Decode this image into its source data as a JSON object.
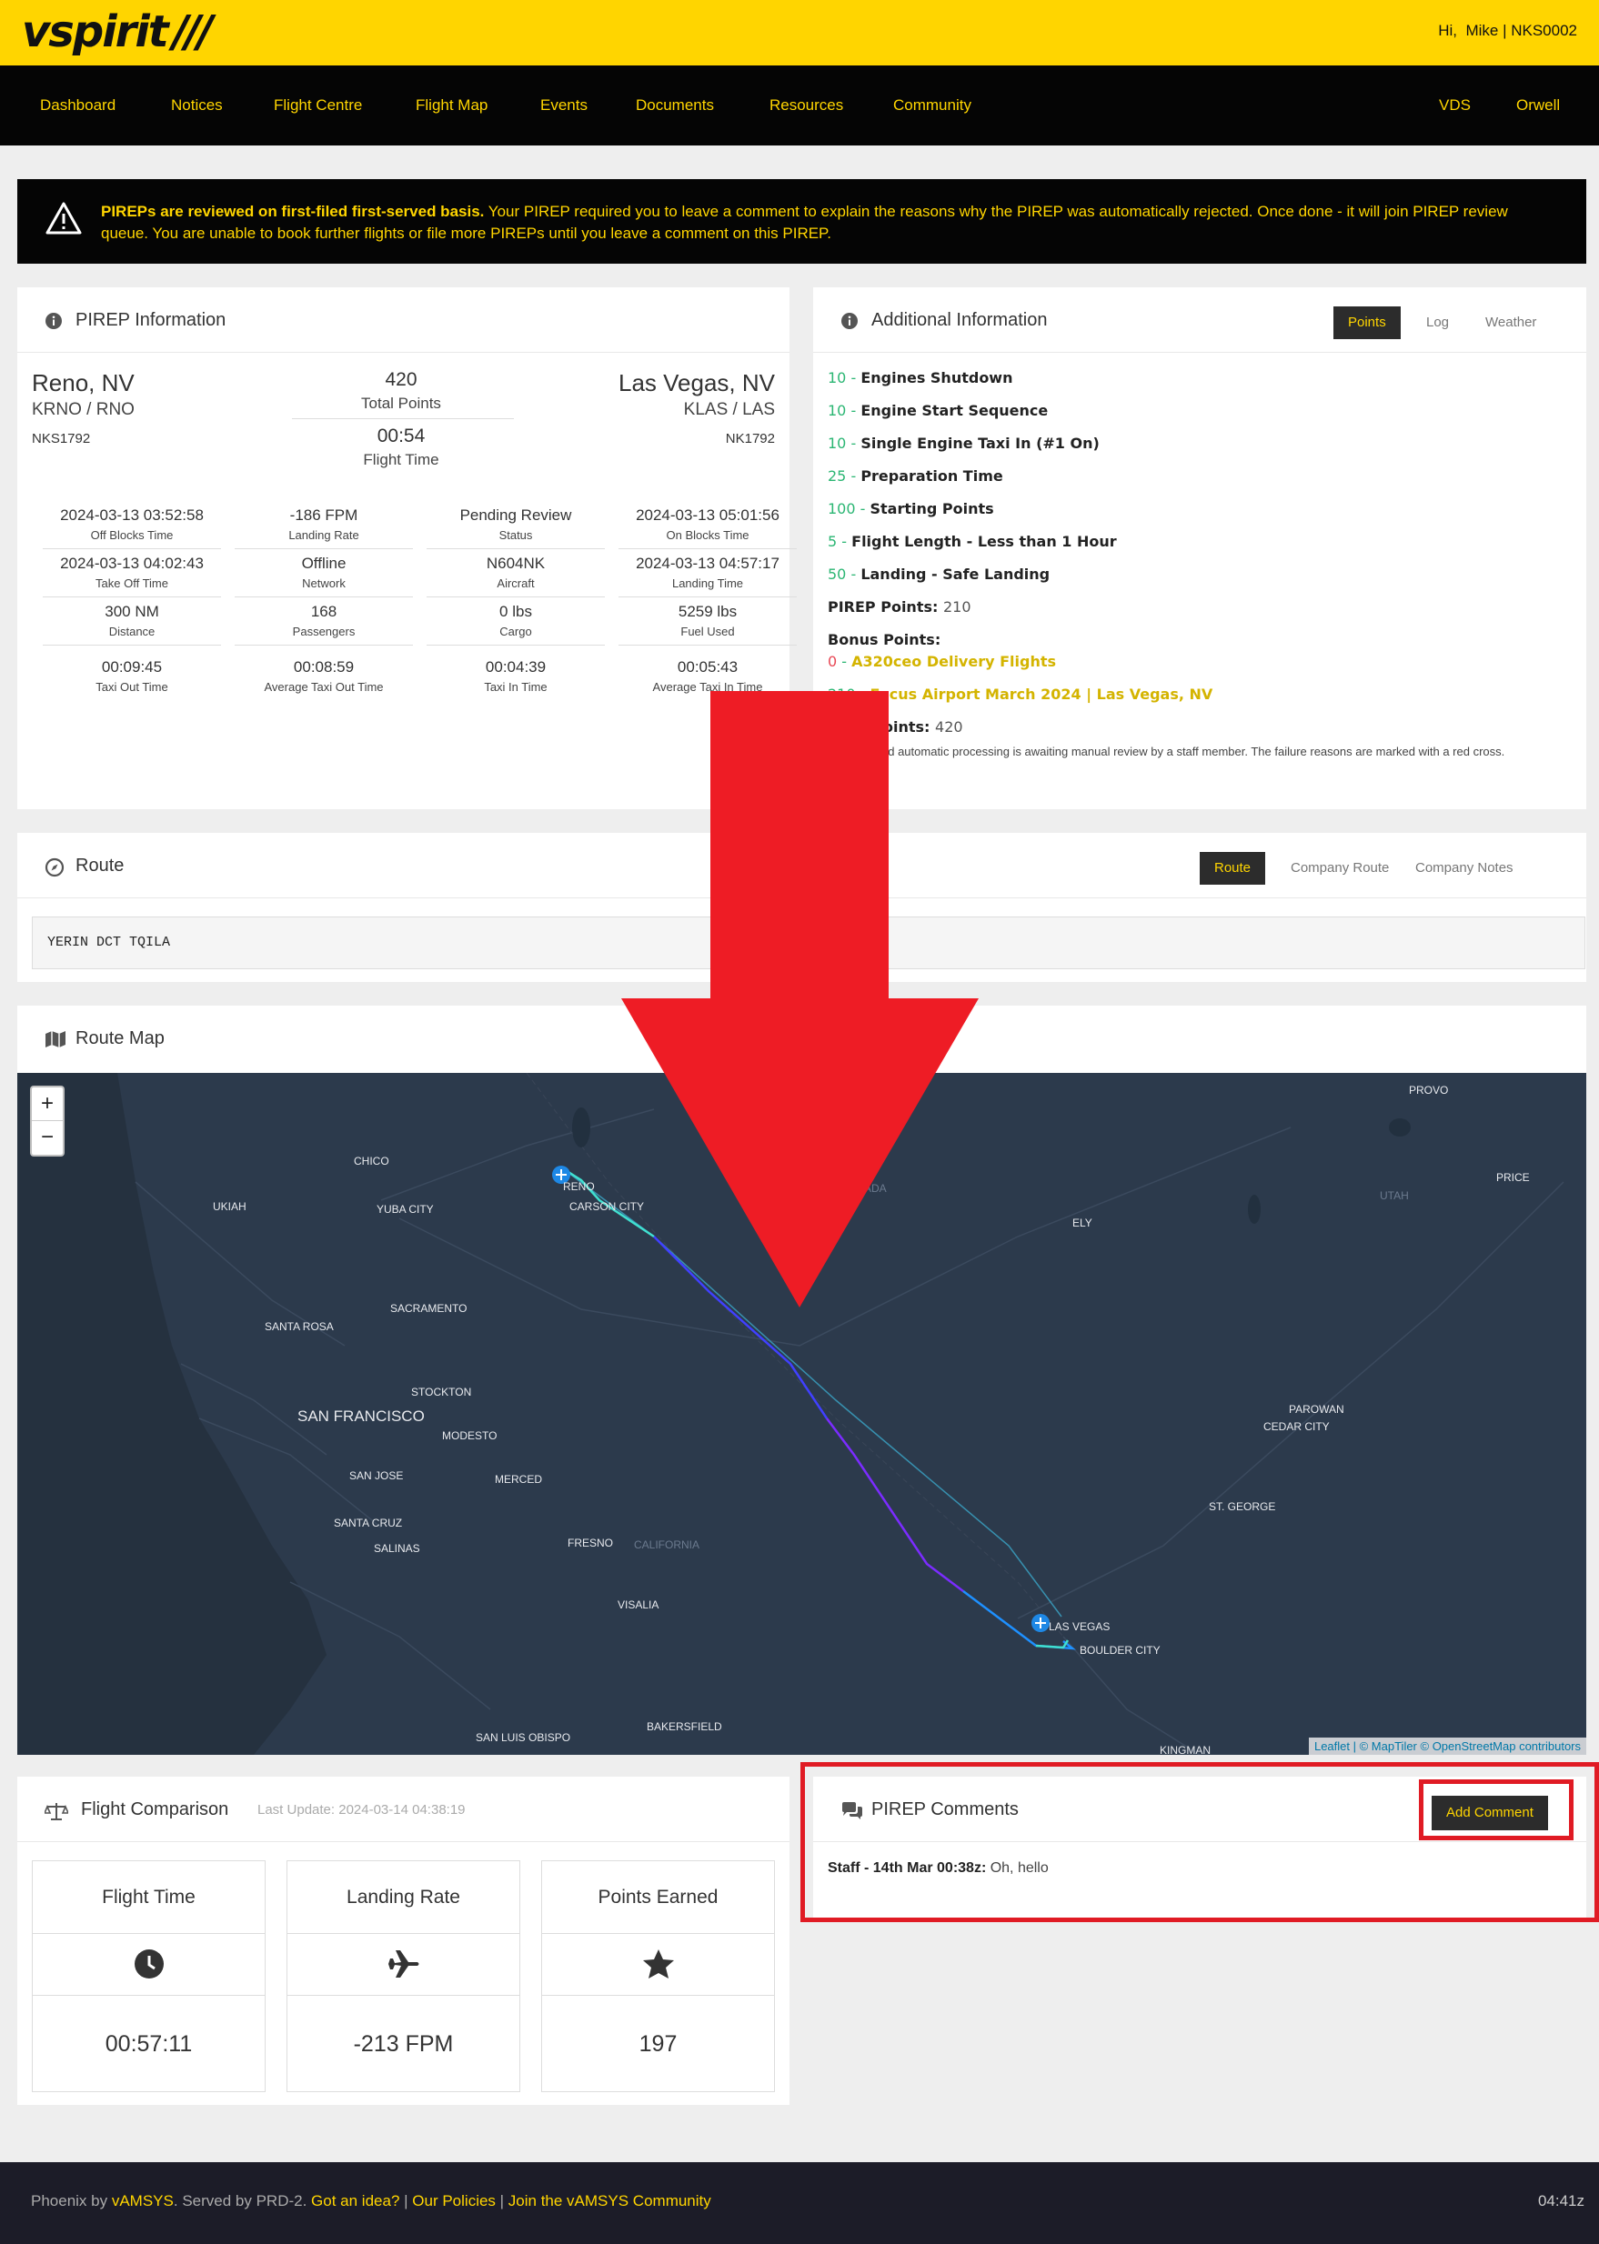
{
  "header": {
    "logo": "vspirit",
    "logo_mark": "///",
    "greeting_prefix": "Hi,",
    "user": "Mike | NKS0002"
  },
  "nav": {
    "items": [
      "Dashboard",
      "Notices",
      "Flight Centre",
      "Flight Map",
      "Events",
      "Documents",
      "Resources",
      "Community"
    ],
    "right_items": [
      "VDS",
      "Orwell"
    ]
  },
  "banner": {
    "bold": "PIREPs are reviewed on first-filed first-served basis.",
    "text": " Your PIREP required you to leave a comment to explain the reasons why the PIREP was automatically rejected. Once done - it will join PIREP review queue. You are unable to book further flights or file more PIREPs until you leave a comment on this PIREP."
  },
  "pirep": {
    "title": "PIREP Information",
    "dep_city": "Reno, NV",
    "dep_codes": "KRNO / RNO",
    "dep_flight": "NKS1792",
    "arr_city": "Las Vegas, NV",
    "arr_codes": "KLAS / LAS",
    "arr_flight": "NK1792",
    "total_points": "420",
    "total_points_label": "Total Points",
    "flight_time": "00:54",
    "flight_time_label": "Flight Time",
    "stats": [
      [
        {
          "value": "2024-03-13 03:52:58",
          "label": "Off Blocks Time"
        },
        {
          "value": "-186 FPM",
          "label": "Landing Rate"
        },
        {
          "value": "Pending Review",
          "label": "Status"
        },
        {
          "value": "2024-03-13 05:01:56",
          "label": "On Blocks Time"
        }
      ],
      [
        {
          "value": "2024-03-13 04:02:43",
          "label": "Take Off Time"
        },
        {
          "value": "Offline",
          "label": "Network"
        },
        {
          "value": "N604NK",
          "label": "Aircraft"
        },
        {
          "value": "2024-03-13 04:57:17",
          "label": "Landing Time"
        }
      ],
      [
        {
          "value": "300 NM",
          "label": "Distance"
        },
        {
          "value": "168",
          "label": "Passengers"
        },
        {
          "value": "0 lbs",
          "label": "Cargo"
        },
        {
          "value": "5259 lbs",
          "label": "Fuel Used"
        }
      ],
      [
        {
          "value": "00:09:45",
          "label": "Taxi Out Time"
        },
        {
          "value": "00:08:59",
          "label": "Average Taxi Out Time"
        },
        {
          "value": "00:04:39",
          "label": "Taxi In Time"
        },
        {
          "value": "00:05:43",
          "label": "Average Taxi In Time"
        }
      ]
    ]
  },
  "additional": {
    "title": "Additional Information",
    "tabs": [
      "Points",
      "Log",
      "Weather"
    ],
    "points": [
      {
        "n": "10",
        "label": "Engines Shutdown"
      },
      {
        "n": "10",
        "label": "Engine Start Sequence"
      },
      {
        "n": "10",
        "label": "Single Engine Taxi In (#1 On)"
      },
      {
        "n": "25",
        "label": "Preparation Time"
      },
      {
        "n": "100",
        "label": "Starting Points"
      },
      {
        "n": "5",
        "label": "Flight Length - Less than 1 Hour"
      },
      {
        "n": "50",
        "label": "Landing - Safe Landing"
      }
    ],
    "pirep_points_label": "PIREP Points:",
    "pirep_points": "210",
    "bonus_label": "Bonus Points:",
    "bonus": [
      {
        "n": "0",
        "label": "A320ceo Delivery Flights"
      },
      {
        "n": "210",
        "label": "Focus Airport March 2024 | Las Vegas, NV"
      }
    ],
    "total_label": "Total Points:",
    "total": "420",
    "note": "PIREP failed automatic processing is awaiting manual review by a staff member. The failure reasons are marked with a red cross."
  },
  "route": {
    "title": "Route",
    "tabs": [
      "Route",
      "Company Route",
      "Company Notes"
    ],
    "text": "YERIN DCT TQILA"
  },
  "route_map": {
    "title": "Route Map",
    "zoom_in": "+",
    "zoom_out": "−",
    "labels": [
      "PROVO",
      "PRICE",
      "CHICO",
      "RENO",
      "UTAH",
      "UKIAH",
      "YUBA CITY",
      "CARSON CITY",
      "ELY",
      "SACRAMENTO",
      "SANTA ROSA",
      "STOCKTON",
      "SAN FRANCISCO",
      "MODESTO",
      "PAROWAN",
      "CEDAR CITY",
      "SAN JOSE",
      "MERCED",
      "ST. GEORGE",
      "SANTA CRUZ",
      "SALINAS",
      "FRESNO",
      "CALIFORNIA",
      "VISALIA",
      "LAS VEGAS",
      "BOULDER CITY",
      "BAKERSFIELD",
      "SAN LUIS OBISPO",
      "KINGMAN",
      "ADA"
    ],
    "attribution_leaflet": "Leaflet",
    "attribution_rest": " | © MapTiler © OpenStreetMap contributors"
  },
  "comparison": {
    "title": "Flight Comparison",
    "updated": "Last Update: 2024-03-14 04:38:19",
    "boxes": [
      {
        "label": "Flight Time",
        "icon": "clock-icon",
        "value": "00:57:11"
      },
      {
        "label": "Landing Rate",
        "icon": "plane-icon",
        "value": "-213 FPM"
      },
      {
        "label": "Points Earned",
        "icon": "star-icon",
        "value": "197"
      }
    ]
  },
  "comments": {
    "title": "PIREP Comments",
    "add_button": "Add Comment",
    "entry_author": "Staff - 14th Mar 00:38z:",
    "entry_text": " Oh, hello"
  },
  "footer": {
    "prefix": "Phoenix by ",
    "brand": "vAMSYS",
    "served": ". Served by PRD-2. ",
    "idea": "Got an idea?",
    "sep": " | ",
    "policies": "Our Policies",
    "community": "Join the vAMSYS Community",
    "time": "04:41z"
  },
  "colors": {
    "brand_yellow": "#ffd500",
    "dark": "#050505",
    "points_green": "#2bb673",
    "annotation_red": "#e01b24",
    "map_bg": "#2c3a4c"
  }
}
